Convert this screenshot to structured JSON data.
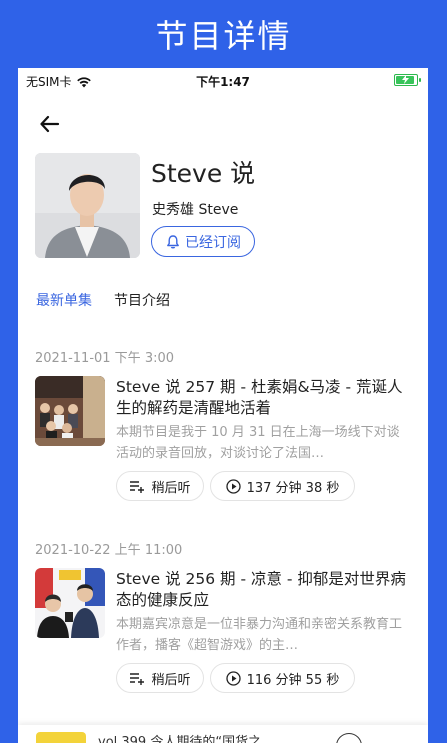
{
  "banner": {
    "title": "节目详情"
  },
  "status_bar": {
    "carrier": "无SIM卡",
    "time": "下午1:47",
    "battery_level": 1.0,
    "battery_color": "#38c45a"
  },
  "show": {
    "title": "Steve 说",
    "author": "史秀雄 Steve",
    "subscribe_label": "已经订阅",
    "accent_color": "#3a66e0"
  },
  "tabs": [
    {
      "label": "最新单集",
      "active": true
    },
    {
      "label": "节目介绍",
      "active": false
    }
  ],
  "episodes": [
    {
      "date": "2021-11-01 下午 3:00",
      "title": "Steve 说 257 期 - 杜素娟&马凌 - 荒诞人生的解药是清醒地活着",
      "description": "本期节目是我于 10 月 31 日在上海一场线下对谈活动的录音回放，对谈讨论了法国…",
      "later_label": "稍后听",
      "duration": "137 分钟 38 秒"
    },
    {
      "date": "2021-10-22 上午 11:00",
      "title": "Steve 说 256 期 - 凉意 - 抑郁是对世界病态的健康反应",
      "description": "本期嘉宾凉意是一位非暴力沟通和亲密关系教育工作者，播客《超智游戏》的主…",
      "later_label": "稍后听",
      "duration": "116 分钟 55 秒"
    }
  ],
  "mini_player": {
    "text": "vol.399 令人期待的“国货之"
  }
}
